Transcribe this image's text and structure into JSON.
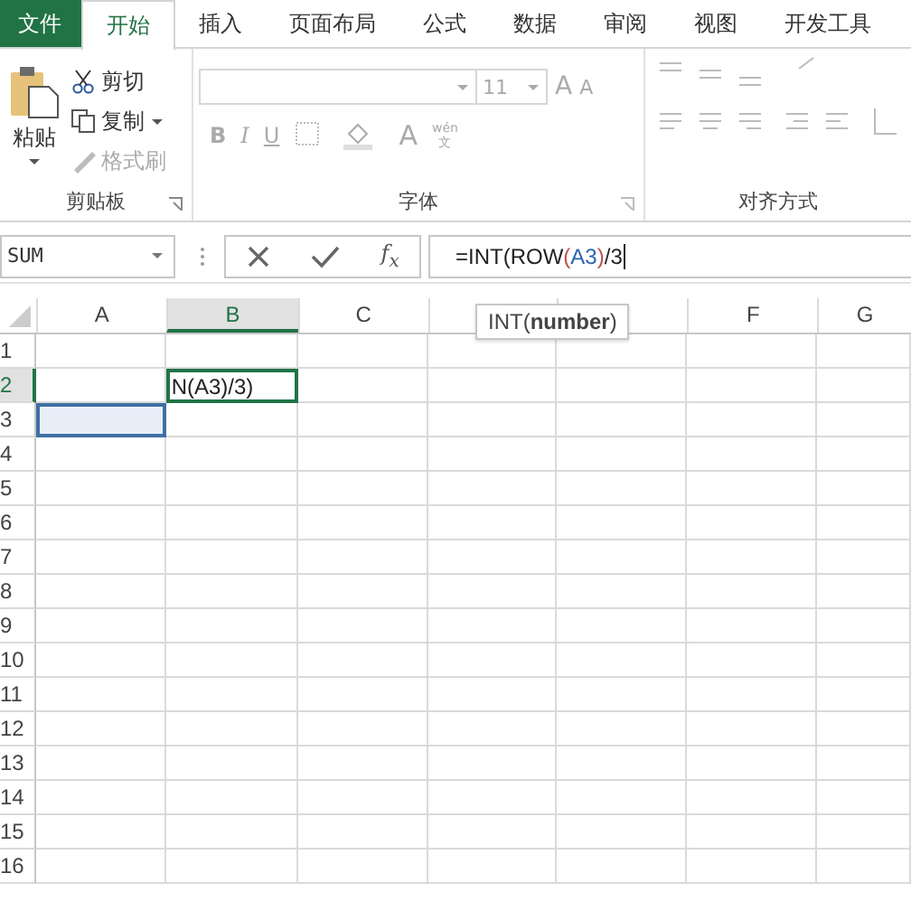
{
  "tabs": [
    {
      "label": "文件",
      "kind": "file",
      "selected": false
    },
    {
      "label": "开始",
      "kind": "tab",
      "selected": true
    },
    {
      "label": "插入",
      "kind": "tab",
      "selected": false
    },
    {
      "label": "页面布局",
      "kind": "tab",
      "selected": false
    },
    {
      "label": "公式",
      "kind": "tab",
      "selected": false
    },
    {
      "label": "数据",
      "kind": "tab",
      "selected": false
    },
    {
      "label": "审阅",
      "kind": "tab",
      "selected": false
    },
    {
      "label": "视图",
      "kind": "tab",
      "selected": false
    },
    {
      "label": "开发工具",
      "kind": "tab",
      "selected": false
    }
  ],
  "clipboard": {
    "paste": "粘贴",
    "cut": "剪切",
    "copy": "复制",
    "format_painter": {
      "label": "格式刷",
      "disabled": true
    },
    "group_label": "剪贴板"
  },
  "font": {
    "size": "11",
    "grow": "A",
    "shrink": "A",
    "bold": "B",
    "italic": "I",
    "underline": "U",
    "font_color": "A",
    "phonetic_top": "wén",
    "phonetic_bottom": "文",
    "group_label": "字体"
  },
  "alignment": {
    "group_label": "对齐方式"
  },
  "name_box": "SUM",
  "fx": "f$_{x}$",
  "formula": [
    {
      "text": "=INT(ROW",
      "kind": "plain"
    },
    {
      "text": "(",
      "kind": "paren"
    },
    {
      "text": "A3",
      "kind": "ref"
    },
    {
      "text": ")",
      "kind": "paren"
    },
    {
      "text": "/3",
      "kind": "plain"
    }
  ],
  "tooltip": "INT(**number**)",
  "columns": [
    {
      "label": "A",
      "selected": false
    },
    {
      "label": "B",
      "selected": true
    },
    {
      "label": "C",
      "selected": false
    },
    {
      "selected": false
    },
    {
      "selected": false
    },
    {
      "label": "F",
      "selected": false
    },
    {
      "label": "G",
      "selected": false
    }
  ],
  "rows": [
    {
      "label": "1",
      "selected": false,
      "highlight": false
    },
    {
      "label": "2",
      "selected": true,
      "highlight": false,
      "b_cell": "N(A3)/3)"
    },
    {
      "label": "3",
      "selected": false,
      "highlight": true
    },
    {
      "label": "4",
      "selected": false,
      "highlight": false
    },
    {
      "label": "5",
      "selected": false,
      "highlight": false
    },
    {
      "label": "6",
      "selected": false,
      "highlight": false
    },
    {
      "label": "7",
      "selected": false,
      "highlight": false
    },
    {
      "label": "8",
      "selected": false,
      "highlight": false
    },
    {
      "label": "9",
      "selected": false,
      "highlight": false
    },
    {
      "label": "10",
      "selected": false,
      "highlight": false
    },
    {
      "label": "11",
      "selected": false,
      "highlight": false
    },
    {
      "label": "12",
      "selected": false,
      "highlight": false
    },
    {
      "label": "13",
      "selected": false,
      "highlight": false
    },
    {
      "label": "14",
      "selected": false,
      "highlight": false
    },
    {
      "label": "15",
      "selected": false,
      "highlight": false
    },
    {
      "label": "16",
      "selected": false,
      "highlight": false
    }
  ]
}
